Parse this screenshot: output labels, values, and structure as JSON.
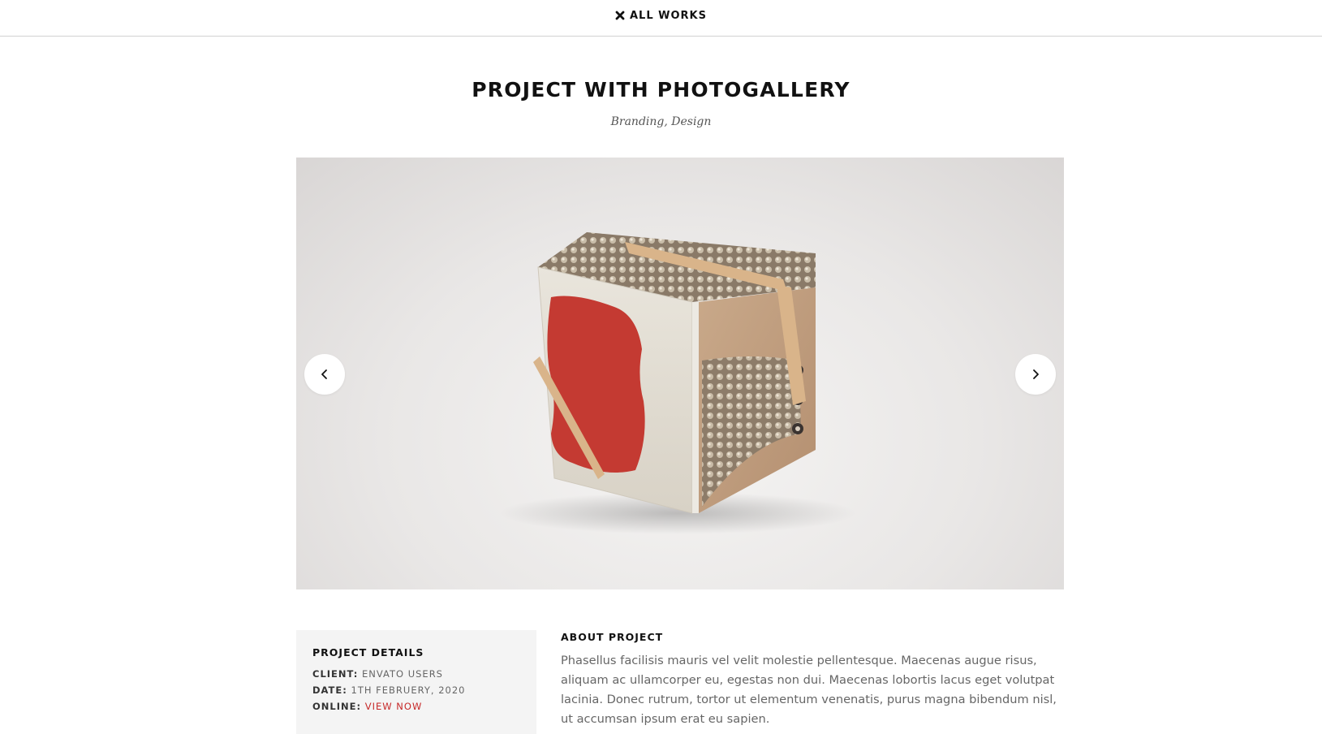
{
  "topbar": {
    "all_works_label": "ALL WORKS",
    "close_icon": "close-icon"
  },
  "project": {
    "title": "PROJECT WITH PHOTOGALLERY",
    "categories": "Branding, Design"
  },
  "gallery": {
    "prev_icon": "chevron-left-icon",
    "next_icon": "chevron-right-icon"
  },
  "details": {
    "heading": "PROJECT DETAILS",
    "client_key": "CLIENT:",
    "client_value": "ENVATO USERS",
    "date_key": "DATE:",
    "date_value": "1TH FEBRUERY, 2020",
    "online_key": "ONLINE:",
    "online_link": "VIEW NOW"
  },
  "about": {
    "heading": "ABOUT PROJECT",
    "text": "Phasellus facilisis mauris vel velit molestie pellentesque. Maecenas augue risus, aliquam ac ullamcorper eu, egestas non dui. Maecenas lobortis lacus eget volutpat lacinia. Donec rutrum, tortor ut elementum venenatis, purus magna bibendum nisl, ut accumsan ipsum erat eu sapien."
  },
  "colors": {
    "accent": "#c62828",
    "text_dark": "#111111",
    "text_muted": "#666666",
    "panel_bg": "#f4f4f4"
  }
}
